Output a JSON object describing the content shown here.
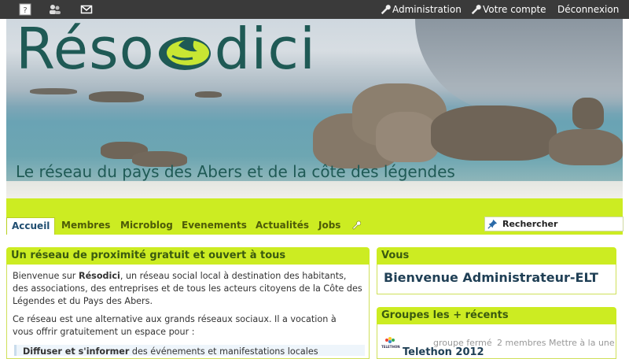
{
  "topbar": {
    "icons": [
      "help-icon",
      "members-icon",
      "mail-icon"
    ],
    "admin_label": "Administration",
    "account_label": "Votre compte",
    "logout_label": "Déconnexion"
  },
  "header": {
    "logo_part1": "Réso",
    "logo_part2": "dici",
    "tagline": "Le réseau du pays des Abers et de la côte des légendes"
  },
  "nav": {
    "tabs": [
      "Accueil",
      "Membres",
      "Microblog",
      "Evenements",
      "Actualités",
      "Jobs"
    ],
    "active_tab": "Accueil",
    "search_label": "Rechercher"
  },
  "main": {
    "title": "Un réseau de proximité gratuit et ouvert à tous",
    "p1_a": "Bienvenue sur ",
    "p1_brand": "Résodici",
    "p1_b": ", un réseau social local à destination des habitants, des associations, des entreprises et de tous les acteurs citoyens de la Côte des Légendes et du Pays des Abers.",
    "p2": "Ce réseau est une alternative aux grands réseaux sociaux. Il a vocation à vous offrir gratuitement un espace pour :",
    "bullet_a": "Diffuser et s'informer",
    "bullet_b": " des événements et manifestations locales"
  },
  "vous": {
    "title": "Vous",
    "welcome": "Bienvenue Administrateur-ELT"
  },
  "groups": {
    "title": "Groupes les + récents",
    "item_name": "Telethon 2012",
    "status": "groupe fermé",
    "members": "2 membres",
    "action": "Mettre à la une",
    "thumb_label": "TELETHON"
  },
  "colors": {
    "accent": "#ccec22",
    "topbar": "#3a3a3a",
    "logo": "#1f5a55"
  }
}
